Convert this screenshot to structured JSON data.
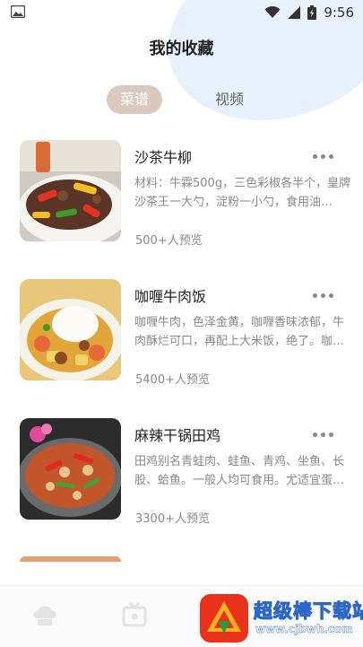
{
  "status_bar": {
    "time": "9:56"
  },
  "header": {
    "title": "我的收藏"
  },
  "tabs": [
    {
      "label": "菜谱",
      "active": true
    },
    {
      "label": "视频",
      "active": false
    }
  ],
  "recipes": [
    {
      "title": "沙茶牛柳",
      "description": "材料：牛霖500g，三色彩椒各半个，皇牌沙茶王一大勺，淀粉一小勺，食用油…",
      "views": "500+人预览",
      "image_icon": "beef-stir-fry-photo"
    },
    {
      "title": "咖喱牛肉饭",
      "description": "咖喱牛肉，色泽金黄，咖喱香味浓郁，牛肉酥烂可口，再配上大米饭，绝了。咖…",
      "views": "5400+人预览",
      "image_icon": "curry-rice-photo"
    },
    {
      "title": "麻辣干锅田鸡",
      "description": "田鸡别名青蛙肉、蛙鱼、青鸡、坐鱼、长股、蛤鱼。一般人均可食用。尤适宜蛋…",
      "views": "3300+人预览",
      "image_icon": "spicy-frog-pot-photo"
    }
  ],
  "watermark": {
    "text": "超级棒下载站",
    "url": "www.cjbwh.com"
  },
  "colors": {
    "tab_active_bg": "#dac9bf",
    "accent_blob": "#e8f1fb"
  }
}
